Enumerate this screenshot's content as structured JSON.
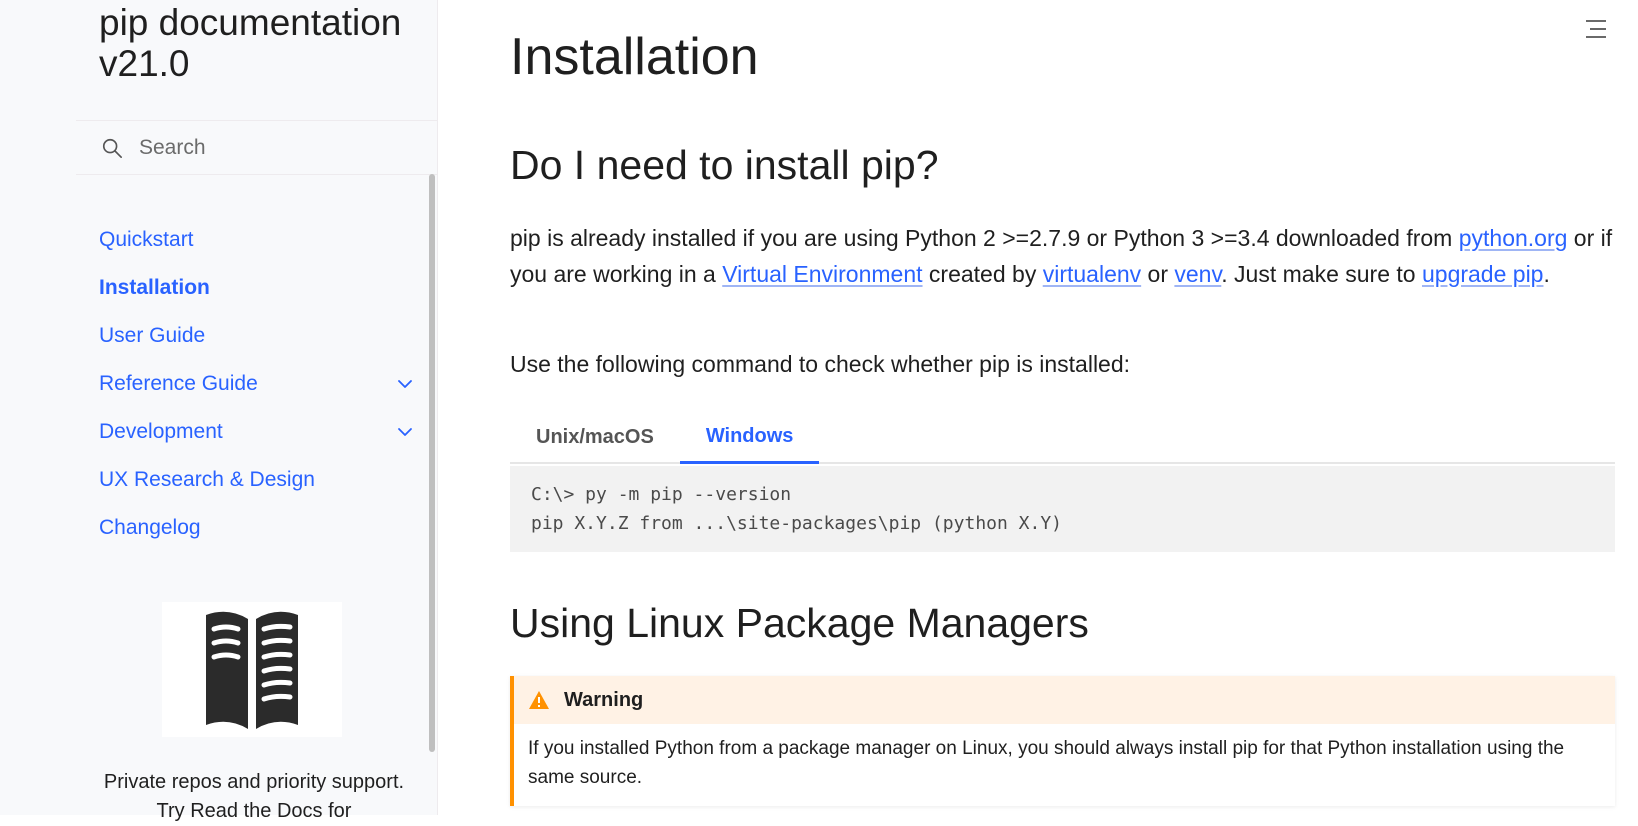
{
  "sidebar": {
    "brand": "pip documentation v21.0",
    "search_placeholder": "Search",
    "items": [
      {
        "label": "Quickstart"
      },
      {
        "label": "Installation"
      },
      {
        "label": "User Guide"
      },
      {
        "label": "Reference Guide"
      },
      {
        "label": "Development"
      },
      {
        "label": "UX Research & Design"
      },
      {
        "label": "Changelog"
      }
    ],
    "ad_text": "Private repos and priority support. Try Read the Docs for"
  },
  "main": {
    "title": "Installation",
    "section1_heading": "Do I need to install pip?",
    "para1": {
      "t1": "pip is already installed if you are using Python 2 >=2.7.9 or Python 3 >=3.4 downloaded from ",
      "link_python_org": "python.org",
      "t2": " or if you are working in a ",
      "link_virtual_env": "Virtual Environment",
      "t3": " created by ",
      "link_virtualenv": "virtualenv",
      "t4": " or ",
      "link_venv": "venv",
      "t5": ". Just make sure to ",
      "link_upgrade": "upgrade pip",
      "t6": "."
    },
    "para2": "Use the following command to check whether pip is installed:",
    "tabs": [
      {
        "label": "Unix/macOS"
      },
      {
        "label": "Windows"
      }
    ],
    "code_lines": [
      "C:\\> py -m pip --version",
      "pip X.Y.Z from ...\\site-packages\\pip (python X.Y)"
    ],
    "section2_heading": "Using Linux Package Managers",
    "warning": {
      "title": "Warning",
      "body": "If you installed Python from a package manager on Linux, you should always install pip for that Python installation using the same source."
    }
  },
  "colors": {
    "accent": "#2962ff",
    "warning": "#ff9100",
    "warning_bg": "#fff2e5",
    "sidebar_bg": "#f8f9fb",
    "code_bg": "#f2f2f2"
  },
  "icons": [
    "search-icon",
    "chevron-down-icon",
    "toc-menu-icon",
    "warning-icon",
    "read-the-docs-logo"
  ]
}
